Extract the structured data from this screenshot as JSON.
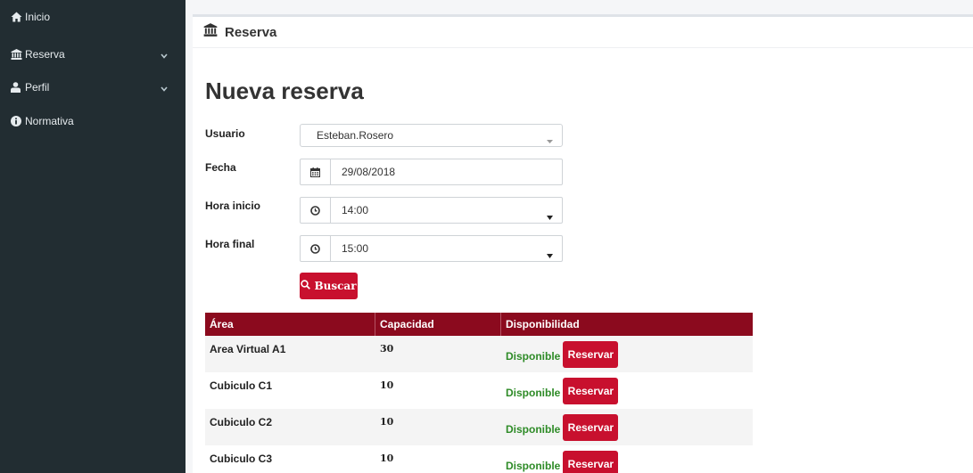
{
  "sidebar": {
    "items": [
      {
        "label": "Inicio",
        "icon": "home-icon"
      },
      {
        "label": "Reserva",
        "icon": "bank-icon"
      },
      {
        "label": "Perfil",
        "icon": "user-icon"
      },
      {
        "label": "Normativa",
        "icon": "info-circle-icon"
      }
    ]
  },
  "header": {
    "title": "Reserva",
    "icon": "bank-icon"
  },
  "page": {
    "title": "Nueva reserva"
  },
  "form": {
    "usuario_label": "Usuario",
    "usuario_value": "Esteban.Rosero",
    "fecha_label": "Fecha",
    "fecha_value": "29/08/2018",
    "hora_inicio_label": "Hora inicio",
    "hora_inicio_value": "14:00",
    "hora_final_label": "Hora final",
    "hora_final_value": "15:00",
    "buscar_label": "Buscar"
  },
  "table": {
    "headers": [
      "Área",
      "Capacidad",
      "Disponibilidad"
    ],
    "rows": [
      {
        "area": "Area Virtual A1",
        "capacidad": "30",
        "estado": "Disponible",
        "accion": "Reservar"
      },
      {
        "area": "Cubiculo C1",
        "capacidad": "10",
        "estado": "Disponible",
        "accion": "Reservar"
      },
      {
        "area": "Cubiculo C2",
        "capacidad": "10",
        "estado": "Disponible",
        "accion": "Reservar"
      },
      {
        "area": "Cubiculo C3",
        "capacidad": "10",
        "estado": "Disponible",
        "accion": "Reservar"
      }
    ]
  },
  "colors": {
    "sidebar_bg": "#222d32",
    "primary_red": "#c8102e",
    "table_header": "#8b0a1e",
    "available_green": "#2e8b27"
  }
}
